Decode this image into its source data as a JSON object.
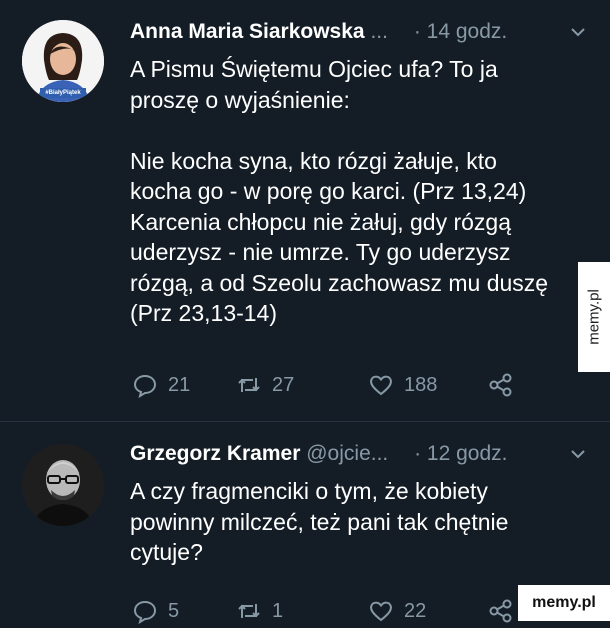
{
  "tweets": [
    {
      "author": "Anna Maria Siarkowska",
      "handle": "...",
      "time": "· 14 godz.",
      "avatar_badge": "#BiałyPiątek",
      "text": "A Pismu Świętemu Ojciec ufa? To ja\nproszę o wyjaśnienie:\n\nNie kocha syna, kto rózgi żałuje, kto\nkocha go - w porę go karci. (Prz 13,24)\nKarcenia chłopcu nie żałuj, gdy rózgą\nuderzysz - nie umrze. Ty go uderzysz\nrózgą, a od Szeolu zachowasz mu duszę\n(Prz 23,13-14)",
      "replies": "21",
      "retweets": "27",
      "likes": "188"
    },
    {
      "author": "Grzegorz Kramer",
      "handle": "@ojcie...",
      "time": "· 12 godz.",
      "text": "A czy fragmenciki o tym, że kobiety\npowinny milczeć, też pani tak chętnie\ncytuje?",
      "replies": "5",
      "retweets": "1",
      "likes": "22"
    }
  ],
  "watermark": {
    "side": "memy.pl",
    "corner": "memy.pl"
  },
  "colors": {
    "background": "#141d26",
    "muted": "#8899a6",
    "text": "#ffffff"
  }
}
